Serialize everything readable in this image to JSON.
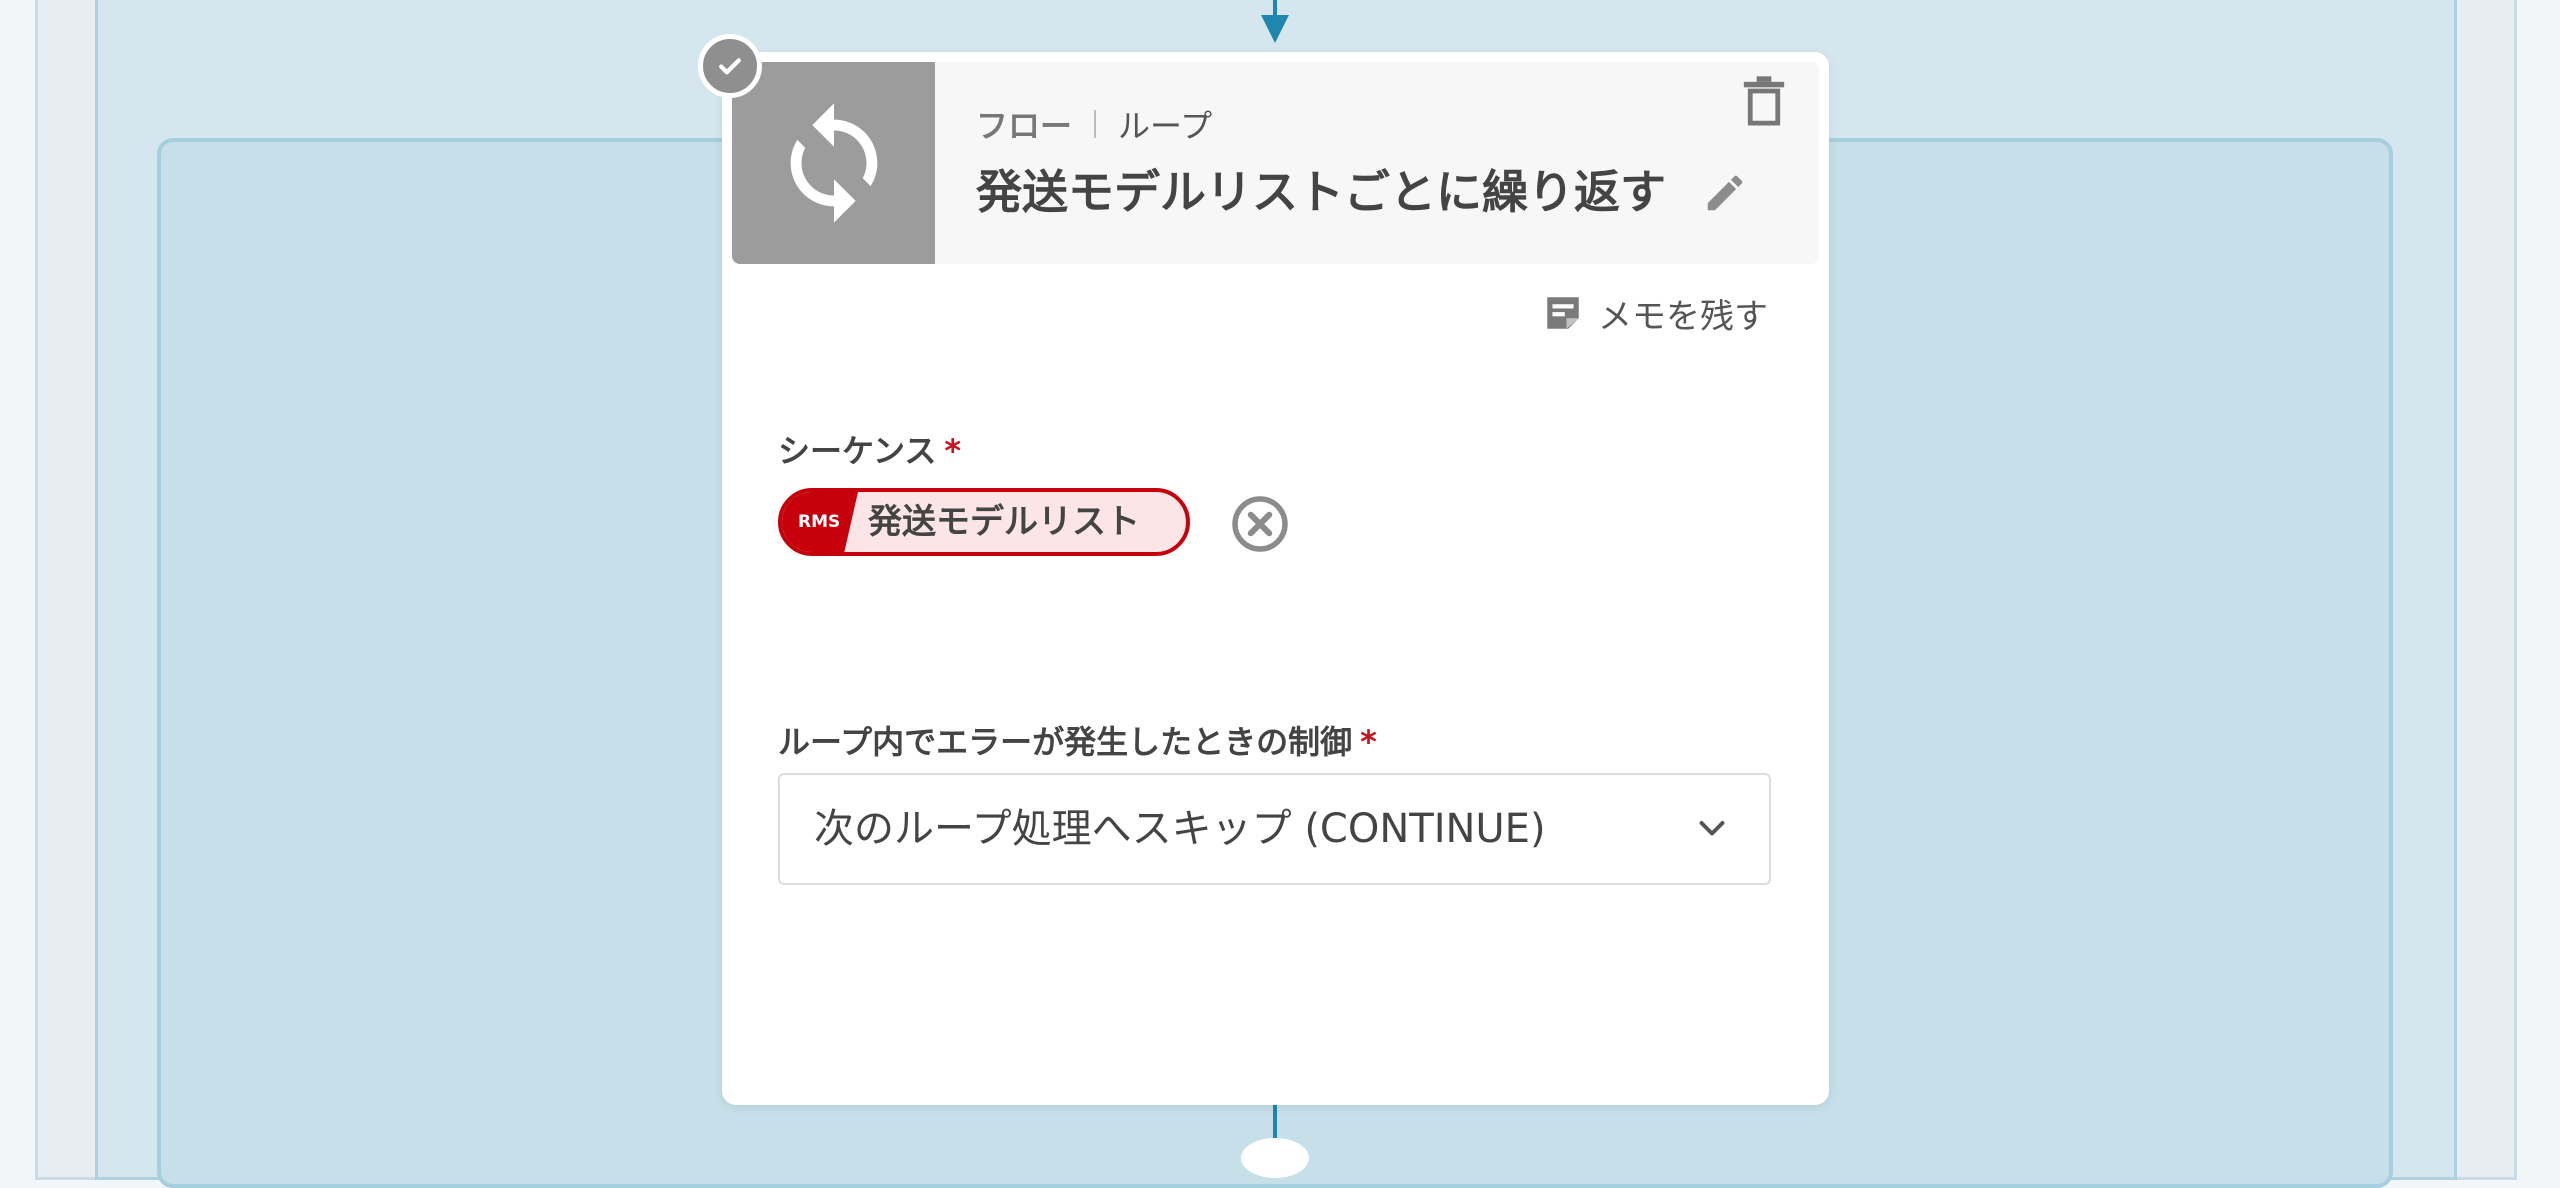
{
  "node": {
    "category": "フロー",
    "subcategory": "ループ",
    "title": "発送モデルリストごとに繰り返す",
    "icon": "loop-icon",
    "memo_label": "メモを残す"
  },
  "fields": {
    "sequence": {
      "label": "シーケンス",
      "required_mark": "*",
      "chip": {
        "badge": "RMS",
        "text": "発送モデルリスト"
      }
    },
    "error_control": {
      "label": "ループ内でエラーが発生したときの制御",
      "required_mark": "*",
      "selected": "次のループ処理へスキップ (CONTINUE)"
    }
  },
  "colors": {
    "accent": "#1f86ad",
    "chip_red": "#c6010c",
    "required": "#c6141f"
  }
}
